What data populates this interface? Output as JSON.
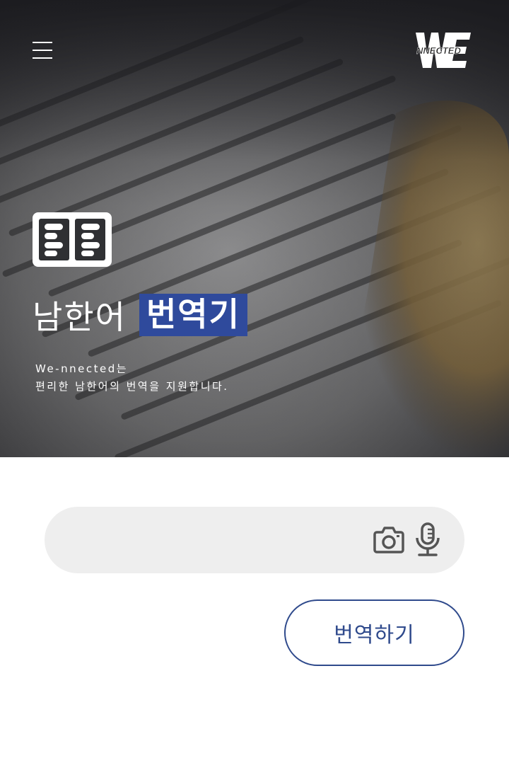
{
  "header": {
    "menu_icon": "hamburger-menu-icon",
    "logo_text": "WE NNECTED",
    "logo_icon": "we-nnected-logo"
  },
  "hero": {
    "background": "dictionary-page-photo",
    "icon": "open-book-icon",
    "title_main": "남한어",
    "title_highlight": "번역기",
    "subtitle_line1": "We-nnected는",
    "subtitle_line2": "편리한 남한어의 번역을 지원합니다.",
    "highlight_color": "#2f4a9c"
  },
  "search": {
    "value": "",
    "placeholder": "",
    "camera_icon": "camera-icon",
    "mic_icon": "microphone-icon",
    "background_color": "#eeeeee"
  },
  "actions": {
    "translate_label": "번역하기",
    "accent_color": "#2f4a8c"
  }
}
